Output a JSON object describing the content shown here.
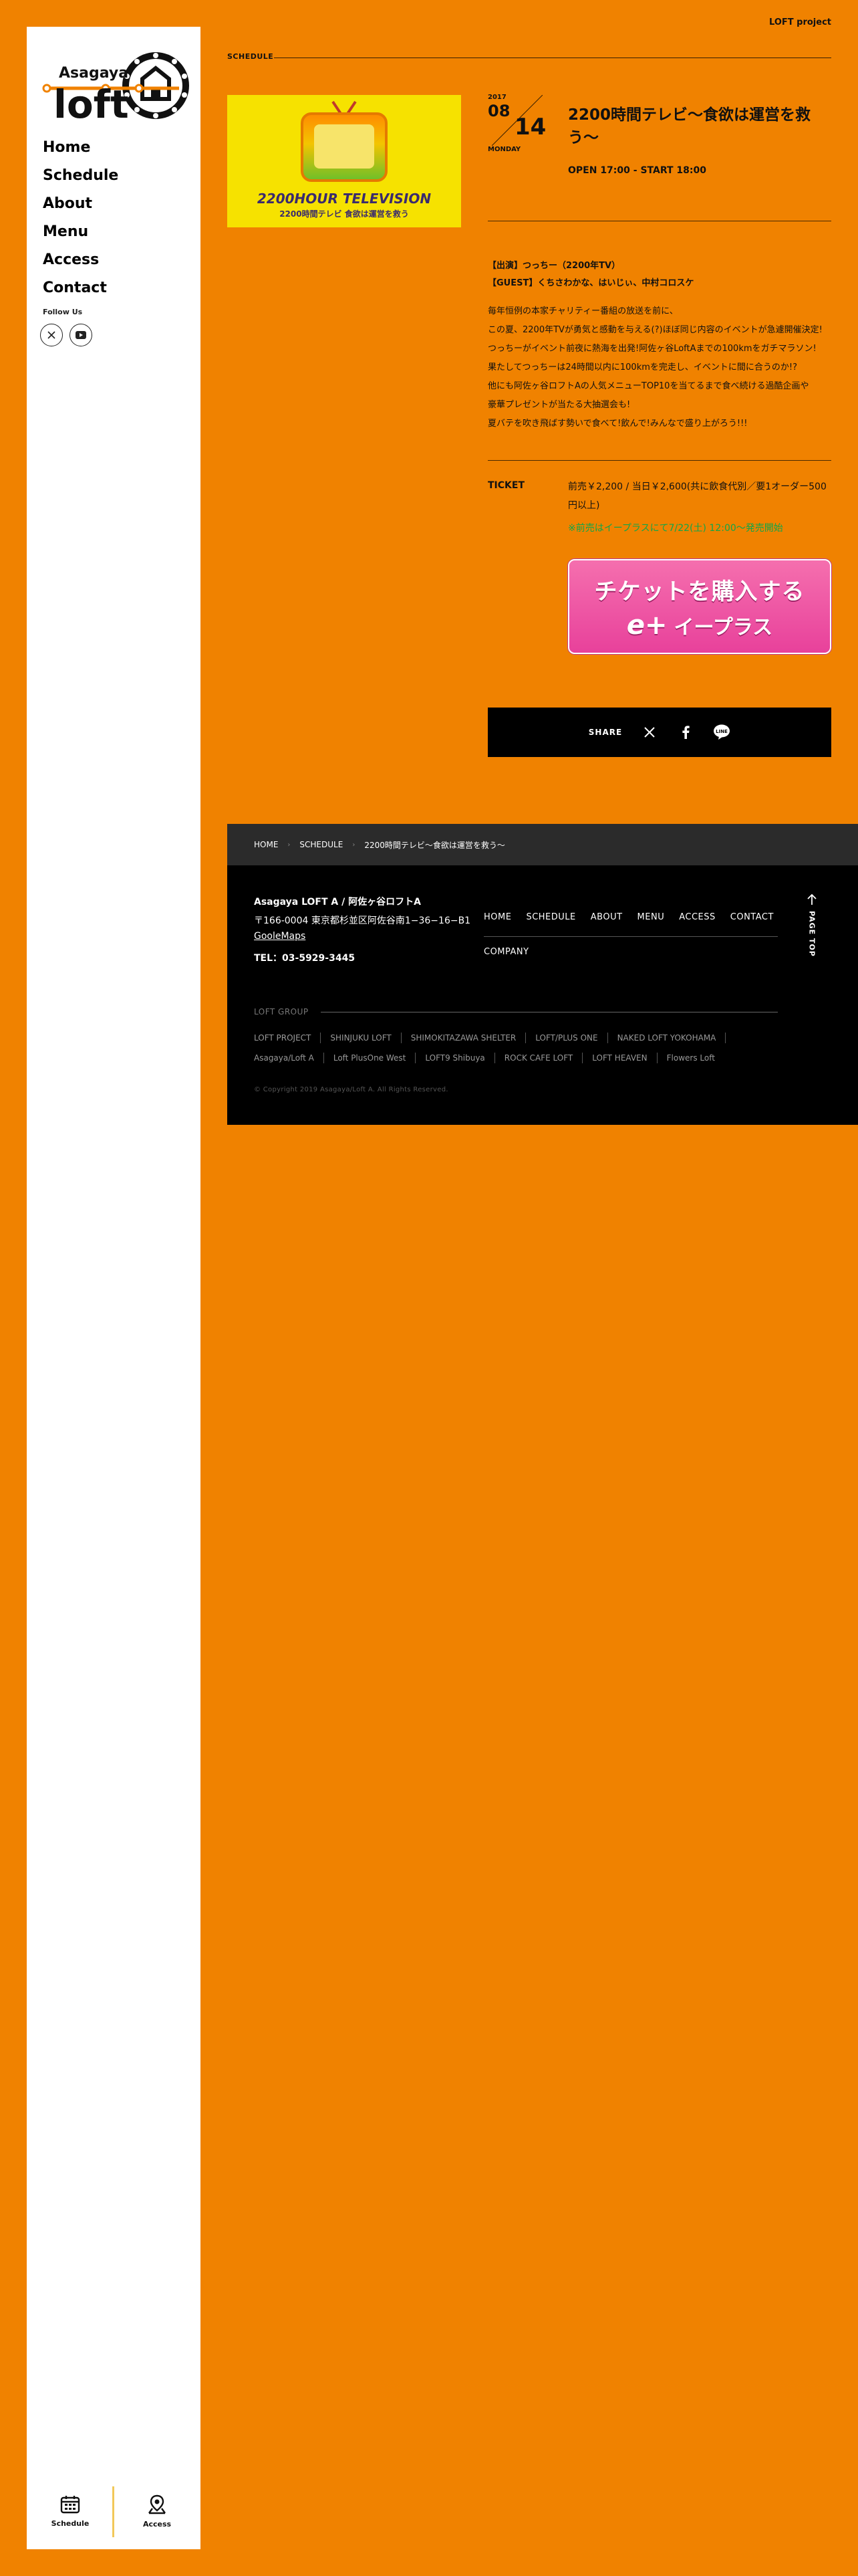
{
  "header": {
    "project_link": "LOFT project",
    "section_label": "SCHEDULE"
  },
  "sidebar": {
    "logo_text_top": "Asagaya",
    "logo_text_main": "loft",
    "nav": [
      {
        "label": "Home"
      },
      {
        "label": "Schedule"
      },
      {
        "label": "About"
      },
      {
        "label": "Menu"
      },
      {
        "label": "Access"
      },
      {
        "label": "Contact"
      }
    ],
    "follow_label": "Follow Us",
    "bottom": {
      "schedule_label": "Schedule",
      "access_label": "Access"
    }
  },
  "event": {
    "date": {
      "year": "2017",
      "month": "08",
      "day": "14",
      "weekday": "MONDAY"
    },
    "title": "2200時間テレビ〜食欲は運営を救う〜",
    "time": "OPEN 17:00 - START 18:00",
    "image": {
      "main_text": "2200HOUR TELEVISION",
      "sub_text": "2200時間テレビ 食欲は運営を救う"
    },
    "performers": [
      "【出演】つっちー（2200年TV）",
      "【GUEST】くちさわかな、はいじぃ、中村コロスケ"
    ],
    "description": [
      "毎年恒例の本家チャリティー番組の放送を前に、",
      "この夏、2200年TVが勇気と感動を与える(?)ほぼ同じ内容のイベントが急遽開催決定!",
      "つっちーがイベント前夜に熱海を出発!阿佐ヶ谷LoftAまでの100kmをガチマラソン!",
      "果たしてつっちーは24時間以内に100kmを完走し、イベントに間に合うのか!?",
      "他にも阿佐ヶ谷ロフトAの人気メニューTOP10を当てるまで食べ続ける過酷企画や",
      "豪華プレゼントが当たる大抽選会も!",
      "夏バテを吹き飛ばす勢いで食べて!飲んで!みんなで盛り上がろう!!!"
    ],
    "ticket": {
      "label": "TICKET",
      "price": "前売￥2,200 / 当日￥2,600(共に飲食代別／要1オーダー500円以上)",
      "note": "※前売はイープラスにて7/22(土) 12:00〜発売開始",
      "button_main": "チケットを購入する",
      "button_logo": "e+",
      "button_brand": "イープラス"
    },
    "share_label": "SHARE"
  },
  "footer": {
    "breadcrumb": [
      "HOME",
      "SCHEDULE",
      "2200時間テレビ〜食欲は運営を救う〜"
    ],
    "venue_name": "Asagaya LOFT A / 阿佐ヶ谷ロフトA",
    "address": "〒166-0004 東京都杉並区阿佐谷南1−36−16−B1",
    "maps_link": "GooleMaps",
    "tel": "TEL：03-5929-3445",
    "nav": [
      "HOME",
      "SCHEDULE",
      "ABOUT",
      "MENU",
      "ACCESS",
      "CONTACT"
    ],
    "company": "COMPANY",
    "page_top": "PAGE TOP",
    "group_label": "LOFT GROUP",
    "group_links": [
      "LOFT PROJECT",
      "SHINJUKU LOFT",
      "SHIMOKITAZAWA SHELTER",
      "LOFT/PLUS ONE",
      "NAKED LOFT YOKOHAMA",
      "Asagaya/Loft A",
      "Loft PlusOne West",
      "LOFT9 Shibuya",
      "ROCK CAFE LOFT",
      "LOFT HEAVEN",
      "Flowers Loft"
    ],
    "copyright": "© Copyright 2019 Asagaya/Loft A. All Rights Reserved."
  },
  "colors": {
    "background": "#f08200",
    "sidebar": "#ffffff",
    "footer": "#000000",
    "note_green": "#0fa74a",
    "eplus_pink": "#e8419b"
  }
}
